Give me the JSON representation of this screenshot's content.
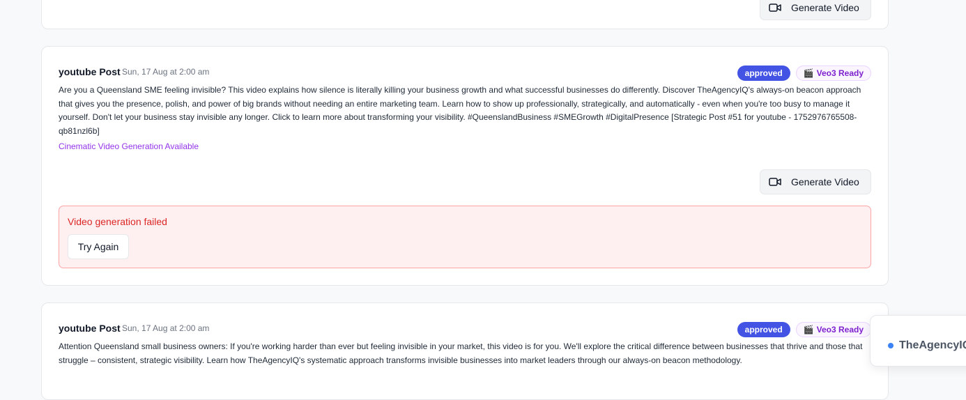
{
  "posts": [
    {
      "generate_label": "Generate Video"
    },
    {
      "title": "youtube Post",
      "date": "Sun, 17 Aug at 2:00 am",
      "status_badge": "approved",
      "veo_badge": "Veo3 Ready",
      "content": "Are you a Queensland SME feeling invisible? This video explains how silence is literally killing your business growth and what successful businesses do differently. Discover TheAgencyIQ's always-on beacon approach that gives you the presence, polish, and power of big brands without needing an entire marketing team. Learn how to show up professionally, strategically, and automatically - even when you're too busy to manage it yourself. Don't let your business stay invisible any longer. Click to learn more about transforming your visibility. #QueenslandBusiness #SMEGrowth #DigitalPresence [Strategic Post #51 for youtube - 1752976765508-qb81nzl6b]",
      "cinematic_label": "Cinematic Video Generation Available",
      "generate_label": "Generate Video",
      "error_message": "Video generation failed",
      "retry_label": "Try Again"
    },
    {
      "title": "youtube Post",
      "date": "Sun, 17 Aug at 2:00 am",
      "status_badge": "approved",
      "veo_badge": "Veo3 Ready",
      "content": "Attention Queensland small business owners: If you're working harder than ever but feeling invisible in your market, this video is for you. We'll explore the critical difference between businesses that thrive and those that struggle – consistent, strategic visibility. Learn how TheAgencyIQ's systematic approach transforms invisible businesses into market leaders through our always-on beacon methodology."
    }
  ],
  "toast": {
    "text": "TheAgencyIQ"
  },
  "colors": {
    "approved_badge": "#4353e4",
    "veo_badge_text": "#7e22ce",
    "cinematic_text": "#9333ea",
    "error_text": "#dc2626",
    "error_bg": "#fef0f0",
    "toast_dot": "#3b82f6"
  },
  "icons": {
    "generate": "video-camera-icon",
    "veo": "clapperboard-icon",
    "toast": "dot-icon"
  }
}
